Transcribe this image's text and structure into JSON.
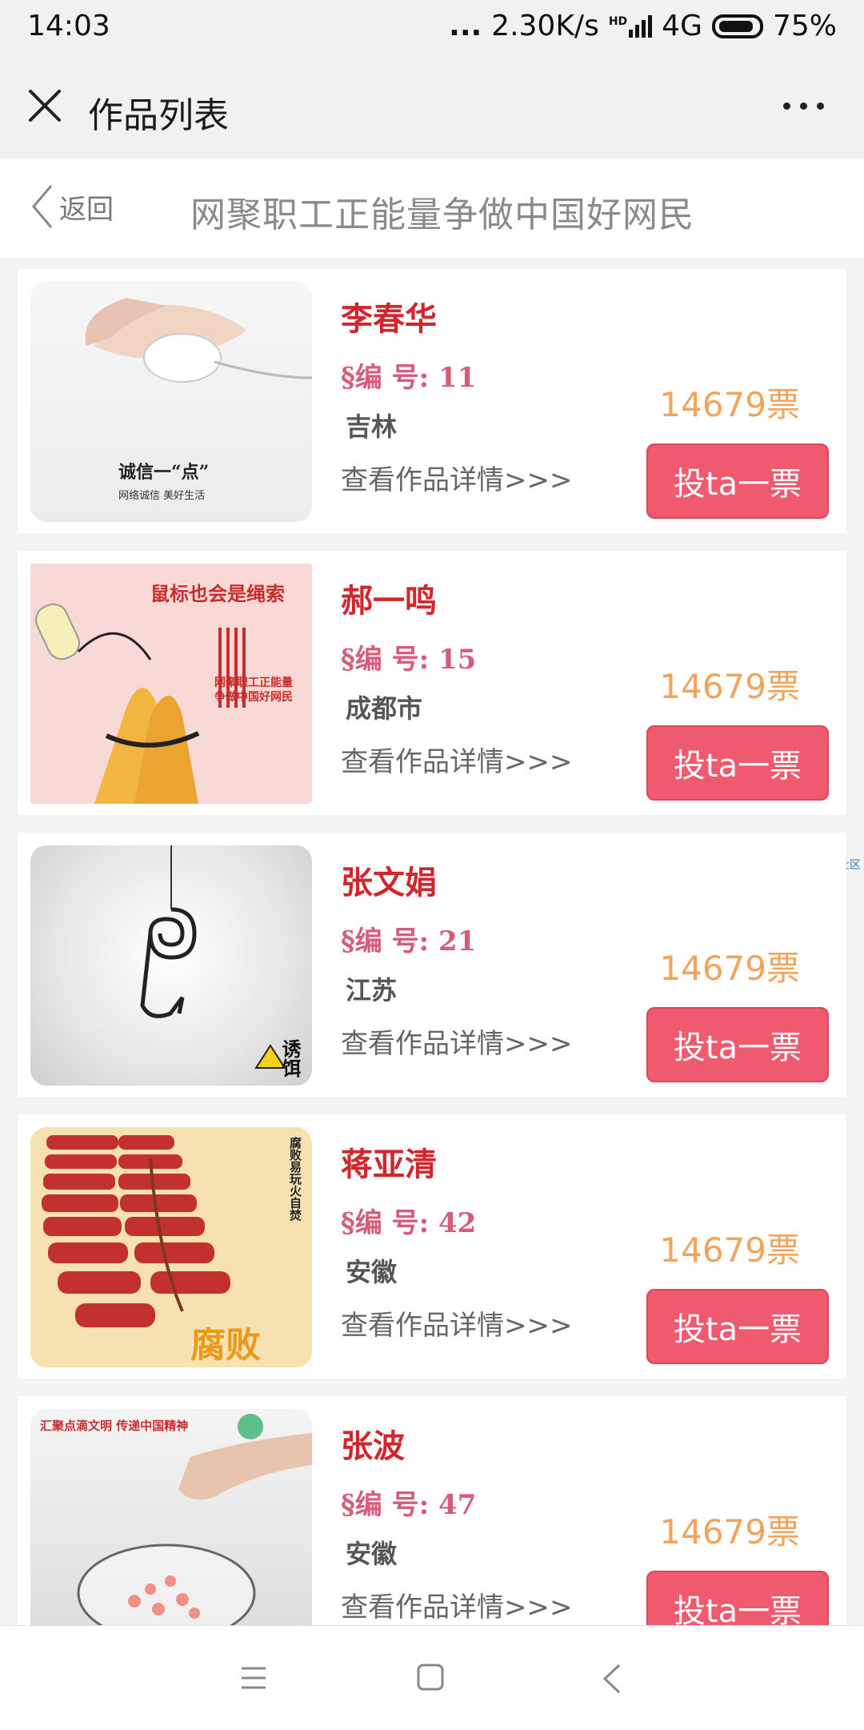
{
  "status": {
    "time": "14:03",
    "dots": "...",
    "speed": "2.30K/s",
    "hd": "HD",
    "net": "4G",
    "battery": "75%"
  },
  "titlebar": {
    "title": "作品列表"
  },
  "subheader": {
    "back_label": "返回",
    "title": "网聚职工正能量争做中国好网民"
  },
  "side_tag": "琼星社区",
  "items": [
    {
      "name": "李春华",
      "code": "§编  号: 11",
      "region": "吉林",
      "detail": "查看作品详情>>>",
      "votes": "14679票",
      "vote_btn": "投ta一票",
      "img_text": "诚信一“点”",
      "img_sub": "网络诚信 美好生活"
    },
    {
      "name": "郝一鸣",
      "code": "§编  号: 15",
      "region": "成都市",
      "detail": "查看作品详情>>>",
      "votes": "14679票",
      "vote_btn": "投ta一票",
      "img_text": "鼠标也会是绳索",
      "img_sub": "网聚职工正能量 争做中国好网民"
    },
    {
      "name": "张文娟",
      "code": "§编  号: 21",
      "region": "江苏",
      "detail": "查看作品详情>>>",
      "votes": "14679票",
      "vote_btn": "投ta一票",
      "img_text": "诱饵",
      "img_sub": ""
    },
    {
      "name": "蒋亚清",
      "code": "§编  号: 42",
      "region": "安徽",
      "detail": "查看作品详情>>>",
      "votes": "14679票",
      "vote_btn": "投ta一票",
      "img_text": "腐败",
      "img_sub": "腐败易玩火自焚"
    },
    {
      "name": "张波",
      "code": "§编  号: 47",
      "region": "安徽",
      "detail": "查看作品详情>>>",
      "votes": "14679票",
      "vote_btn": "投ta一票",
      "img_text": "汇聚点滴文明 传递中国精神",
      "img_sub": ""
    }
  ]
}
